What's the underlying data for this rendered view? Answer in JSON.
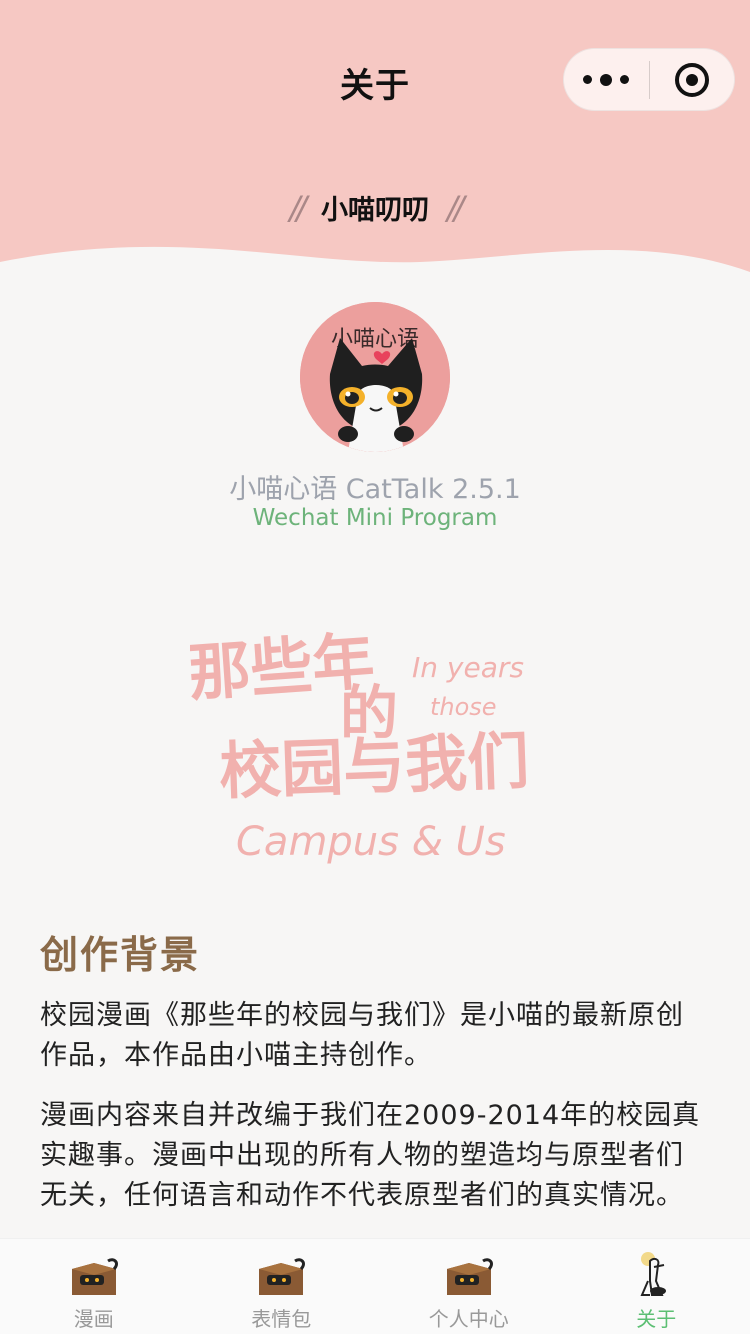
{
  "nav": {
    "title": "关于"
  },
  "header": {
    "subtitle": "小喵叨叨",
    "background_color": "#f6c8c3"
  },
  "about": {
    "app_name": "小喵心语 CatTalk 2.5.1",
    "app_sub": "Wechat Mini Program",
    "logo_text": "小喵心语"
  },
  "banner": {
    "lines": [
      "那些年",
      "的",
      "校园与我们",
      "In years",
      "those",
      "Campus & Us"
    ]
  },
  "content": {
    "section_title": "创作背景",
    "paragraph_1": "校园漫画《那些年的校园与我们》是小喵的最新原创作品，本作品由小喵主持创作。",
    "paragraph_2": "漫画内容来自并改编于我们在2009-2014年的校园真实趣事。漫画中出现的所有人物的塑造均与原型者们无关，任何语言和动作不代表原型者们的真实情况。"
  },
  "tabbar": {
    "items": [
      {
        "label": "漫画",
        "icon": "cat-in-box-icon",
        "active": false
      },
      {
        "label": "表情包",
        "icon": "cat-in-box-icon",
        "active": false
      },
      {
        "label": "个人中心",
        "icon": "cat-in-box-icon",
        "active": false
      },
      {
        "label": "关于",
        "icon": "cat-standing-icon",
        "active": true
      }
    ],
    "active_color": "#5cbf73",
    "inactive_color": "#999999"
  }
}
